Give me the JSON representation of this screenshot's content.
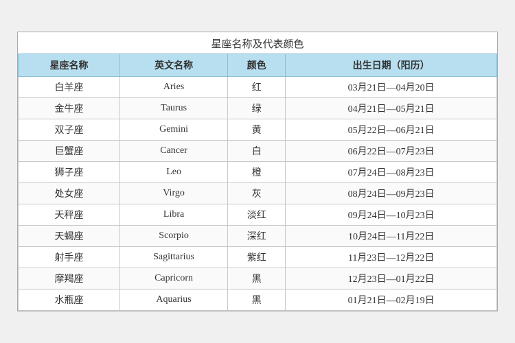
{
  "title": "星座名称及代表颜色",
  "headers": [
    "星座名称",
    "英文名称",
    "颜色",
    "出生日期（阳历）"
  ],
  "rows": [
    {
      "zh": "白羊座",
      "en": "Aries",
      "color": "红",
      "date": "03月21日—04月20日"
    },
    {
      "zh": "金牛座",
      "en": "Taurus",
      "color": "绿",
      "date": "04月21日—05月21日"
    },
    {
      "zh": "双子座",
      "en": "Gemini",
      "color": "黄",
      "date": "05月22日—06月21日"
    },
    {
      "zh": "巨蟹座",
      "en": "Cancer",
      "color": "白",
      "date": "06月22日—07月23日"
    },
    {
      "zh": "狮子座",
      "en": "Leo",
      "color": "橙",
      "date": "07月24日—08月23日"
    },
    {
      "zh": "处女座",
      "en": "Virgo",
      "color": "灰",
      "date": "08月24日—09月23日"
    },
    {
      "zh": "天秤座",
      "en": "Libra",
      "color": "淡红",
      "date": "09月24日—10月23日"
    },
    {
      "zh": "天蝎座",
      "en": "Scorpio",
      "color": "深红",
      "date": "10月24日—11月22日"
    },
    {
      "zh": "射手座",
      "en": "Sagittarius",
      "color": "紫红",
      "date": "11月23日—12月22日"
    },
    {
      "zh": "摩羯座",
      "en": "Capricorn",
      "color": "黑",
      "date": "12月23日—01月22日"
    },
    {
      "zh": "水瓶座",
      "en": "Aquarius",
      "color": "黑",
      "date": "01月21日—02月19日"
    }
  ]
}
